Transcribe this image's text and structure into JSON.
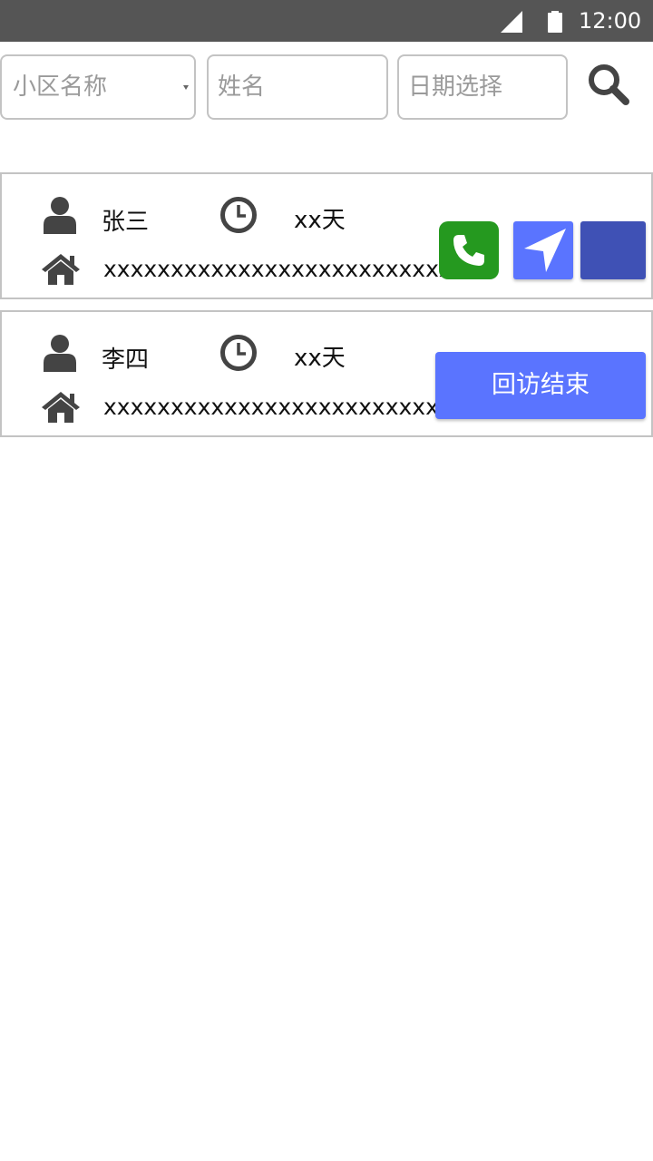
{
  "status_bar": {
    "time": "12:00",
    "background": "#555555"
  },
  "filters": {
    "community_select": {
      "value": "小区名称"
    },
    "name_input": {
      "placeholder": "姓名"
    },
    "date_input": {
      "placeholder": "日期选择"
    },
    "search_icon": "search-icon"
  },
  "visits": [
    {
      "name": "张三",
      "days": "xx天",
      "address": "xxxxxxxxxxxxxxxxxxxxxxxxxxx",
      "actions": [
        "phone-icon",
        "navigation-icon",
        "square-button"
      ]
    },
    {
      "name": "李四",
      "days": "xx天",
      "address": "xxxxxxxxxxxxxxxxxxxxxxxxxxx",
      "end_label": "回访结束"
    }
  ],
  "colors": {
    "phone_green": "#25991f",
    "accent_blue": "#5a74ff",
    "indigo": "#3f51b5",
    "icon_gray": "#444444"
  }
}
